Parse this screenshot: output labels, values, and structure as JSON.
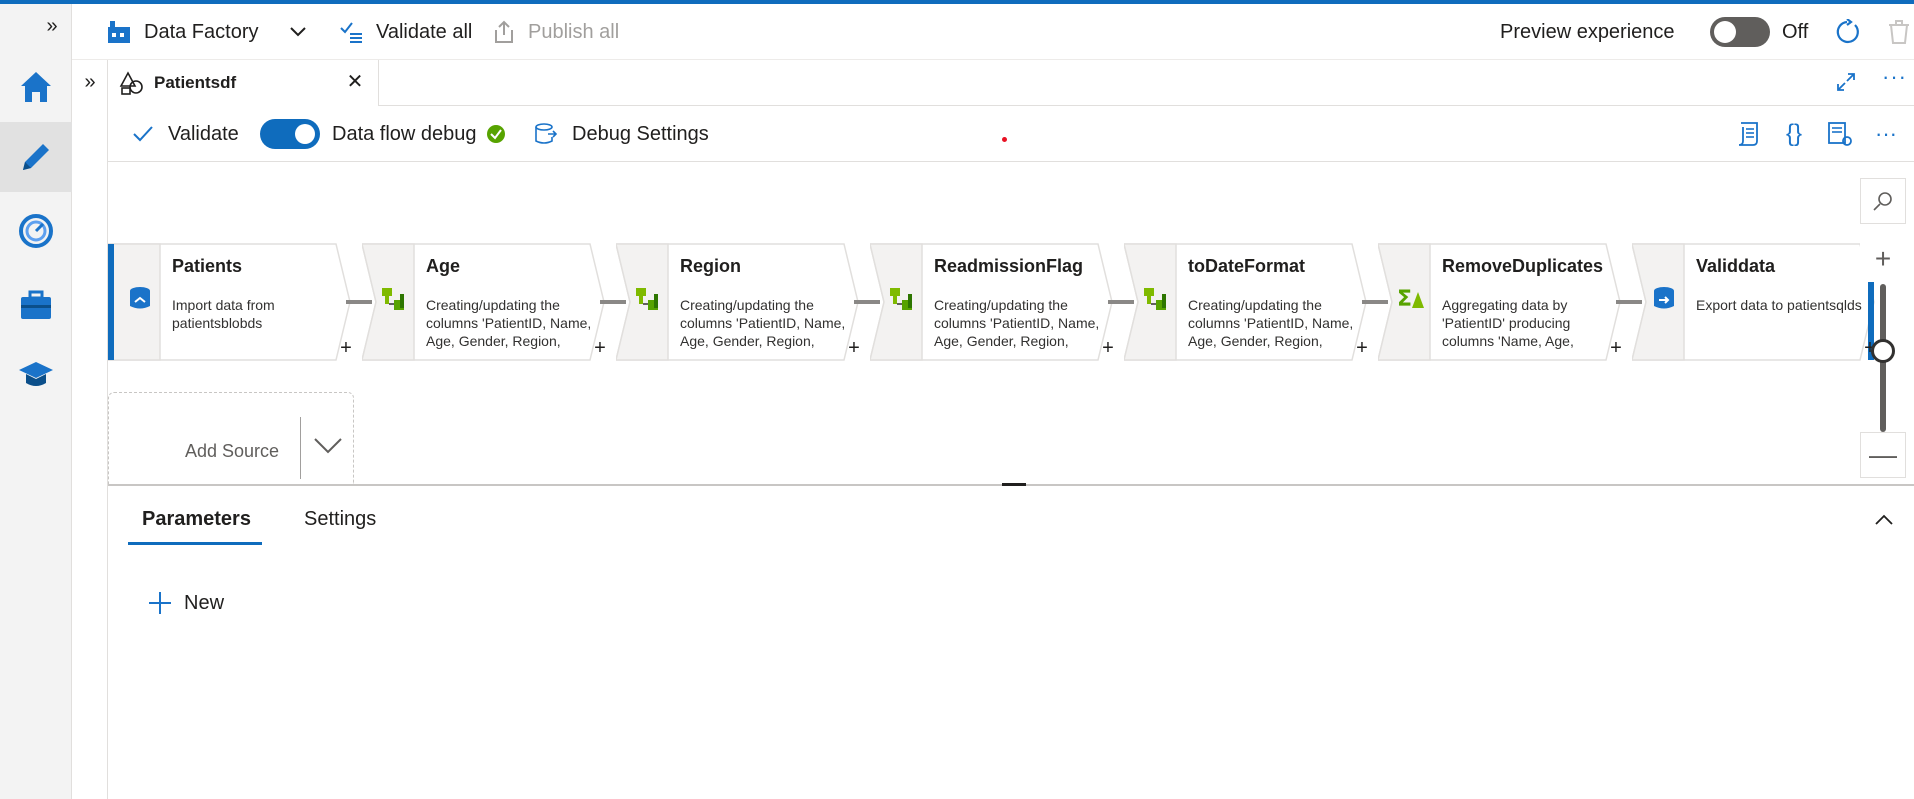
{
  "app": {
    "factory_name": "Data Factory",
    "validate_all": "Validate all",
    "publish_all": "Publish all",
    "preview_label": "Preview experience",
    "preview_state": "Off"
  },
  "tab": {
    "title": "Patientsdf"
  },
  "canvas_toolbar": {
    "validate": "Validate",
    "debug_label": "Data flow debug",
    "debug_settings": "Debug Settings"
  },
  "nodes": [
    {
      "title": "Patients",
      "desc": "Import data from patientsblobds",
      "icon": "source-icon"
    },
    {
      "title": "Age",
      "desc": "Creating/updating the columns 'PatientID, Name, Age, Gender, Region, ICDCode'",
      "icon": "derived-column-icon"
    },
    {
      "title": "Region",
      "desc": "Creating/updating the columns 'PatientID, Name, Age, Gender, Region, ICDCode'",
      "icon": "derived-column-icon"
    },
    {
      "title": "ReadmissionFlag",
      "desc": "Creating/updating the columns 'PatientID, Name, Age, Gender, Region, ICDCode'",
      "icon": "derived-column-icon"
    },
    {
      "title": "toDateFormat",
      "desc": "Creating/updating the columns 'PatientID, Name, Age, Gender, Region, ICDCode'",
      "icon": "derived-column-icon"
    },
    {
      "title": "RemoveDuplicates",
      "desc": "Aggregating data by 'PatientID' producing columns 'Name, Age, Gender, Region'",
      "icon": "aggregate-icon"
    },
    {
      "title": "Validdata",
      "desc": "Export data to patientsqlds",
      "icon": "sink-icon"
    }
  ],
  "add_source": "Add Source",
  "panel": {
    "tabs": [
      "Parameters",
      "Settings"
    ],
    "new": "New"
  },
  "colors": {
    "accent": "#0f6cbd",
    "ok": "#107c10"
  }
}
